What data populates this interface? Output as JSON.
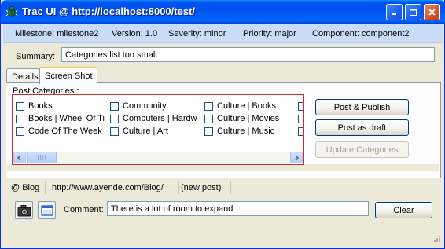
{
  "window": {
    "title": "Trac UI @ http://localhost:8000/test/"
  },
  "infobar": {
    "milestone": "Milestone: milestone2",
    "version": "Version: 1.0",
    "severity": "Severity: minor",
    "priority": "Priority: major",
    "component": "Component: component2"
  },
  "summary": {
    "label": "Summary:",
    "value": "Categories list too small"
  },
  "tabs": [
    {
      "label": "Details"
    },
    {
      "label": "Screen Shot"
    }
  ],
  "post_categories": {
    "label": "Post Categories :",
    "items": [
      {
        "label": "Books"
      },
      {
        "label": "Community"
      },
      {
        "label": "Culture | Books"
      },
      {
        "label": "Books | Wheel Of Ti"
      },
      {
        "label": "Computers | Hardw"
      },
      {
        "label": "Culture | Movies"
      },
      {
        "label": "Code Of The Week"
      },
      {
        "label": "Culture | Art"
      },
      {
        "label": "Culture | Music"
      }
    ]
  },
  "buttons": {
    "publish": "Post & Publish",
    "draft": "Post as draft",
    "update": "Update Categories",
    "clear": "Clear"
  },
  "status": {
    "blog": "@ Blog",
    "url": "http://www.ayende.com/Blog/",
    "post": "(new post)"
  },
  "comment": {
    "label": "Comment:",
    "value": "There is a lot of room to expand"
  },
  "colors": {
    "title_bar": "#0053ee",
    "info_bar": "#c9ddf8",
    "window_bg": "#ece9d8",
    "tab_highlight": "#ffc83c",
    "categories_border": "#d42a2a"
  }
}
